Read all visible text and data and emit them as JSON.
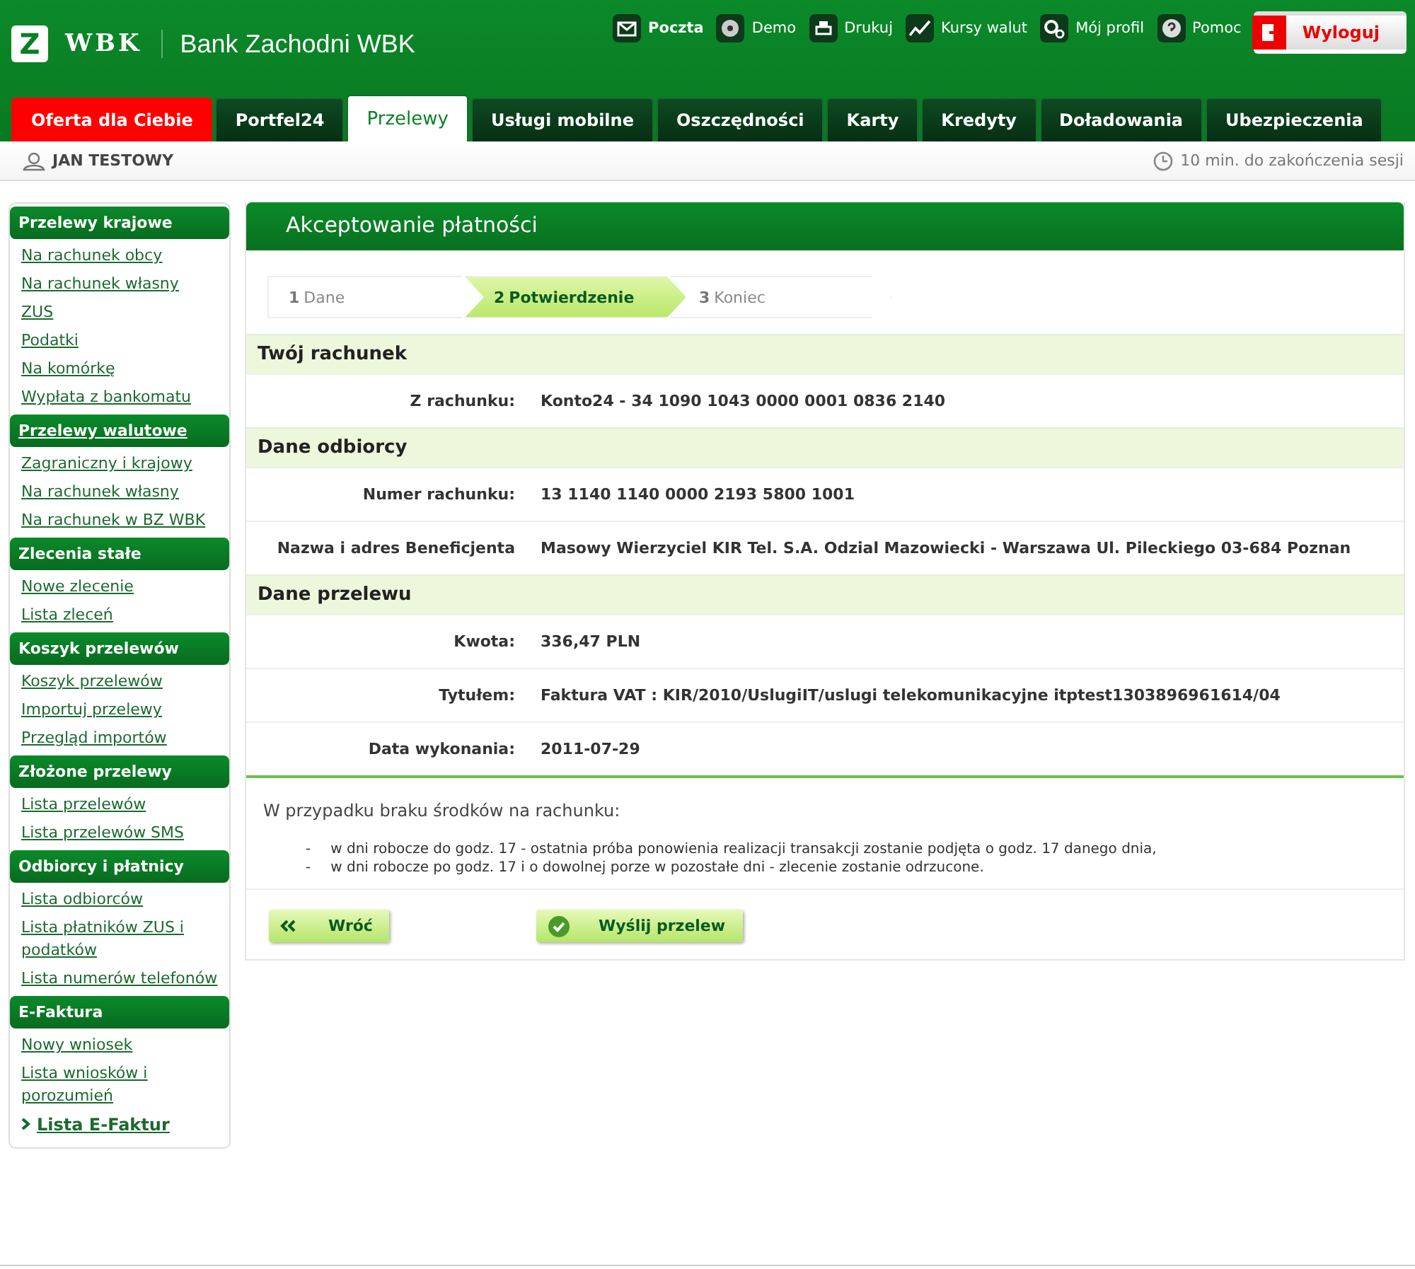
{
  "header": {
    "logo_mark": "Z",
    "logo_text": "WBK",
    "bank_name": "Bank Zachodni WBK",
    "top_links": [
      {
        "label": "Poczta",
        "kind": "mail",
        "bold": true
      },
      {
        "label": "Demo",
        "kind": "demo",
        "bold": false
      },
      {
        "label": "Drukuj",
        "kind": "print",
        "bold": false
      },
      {
        "label": "Kursy walut",
        "kind": "chart",
        "bold": false
      },
      {
        "label": "Mój profil",
        "kind": "gear",
        "bold": false
      },
      {
        "label": "Pomoc",
        "kind": "help",
        "bold": false
      }
    ],
    "logout": "Wyloguj"
  },
  "tabs": [
    {
      "label": "Oferta dla Ciebie",
      "kind": "promo",
      "selected": false
    },
    {
      "label": "Portfel24",
      "kind": "normal",
      "selected": false
    },
    {
      "label": "Przelewy",
      "kind": "normal",
      "selected": true
    },
    {
      "label": "Usługi mobilne",
      "kind": "normal",
      "selected": false
    },
    {
      "label": "Oszczędności",
      "kind": "normal",
      "selected": false
    },
    {
      "label": "Karty",
      "kind": "normal",
      "selected": false
    },
    {
      "label": "Kredyty",
      "kind": "normal",
      "selected": false
    },
    {
      "label": "Doładowania",
      "kind": "normal",
      "selected": false
    },
    {
      "label": "Ubezpieczenia",
      "kind": "normal",
      "selected": false
    }
  ],
  "user_bar": {
    "user": "JAN TESTOWY",
    "session": "10 min. do zakończenia sesji"
  },
  "sidebar": [
    {
      "heading": "Przelewy krajowe",
      "linked": false,
      "items": [
        {
          "label": "Na rachunek obcy",
          "selected": false
        },
        {
          "label": "Na rachunek własny",
          "selected": false
        },
        {
          "label": "ZUS",
          "selected": false
        },
        {
          "label": "Podatki",
          "selected": false
        },
        {
          "label": "Na komórkę",
          "selected": false
        },
        {
          "label": "Wypłata z bankomatu",
          "selected": false
        }
      ]
    },
    {
      "heading": "Przelewy walutowe",
      "linked": true,
      "items": [
        {
          "label": "Zagraniczny i krajowy",
          "selected": false
        },
        {
          "label": "Na rachunek własny",
          "selected": false
        },
        {
          "label": "Na rachunek w BZ WBK",
          "selected": false
        }
      ]
    },
    {
      "heading": "Zlecenia stałe",
      "linked": false,
      "items": [
        {
          "label": "Nowe zlecenie",
          "selected": false
        },
        {
          "label": "Lista zleceń",
          "selected": false
        }
      ]
    },
    {
      "heading": "Koszyk przelewów",
      "linked": false,
      "items": [
        {
          "label": "Koszyk przelewów",
          "selected": false
        },
        {
          "label": "Importuj przelewy",
          "selected": false
        },
        {
          "label": "Przegląd importów",
          "selected": false
        }
      ]
    },
    {
      "heading": "Złożone przelewy",
      "linked": false,
      "items": [
        {
          "label": "Lista przelewów",
          "selected": false
        },
        {
          "label": "Lista przelewów SMS",
          "selected": false
        }
      ]
    },
    {
      "heading": "Odbiorcy i płatnicy",
      "linked": false,
      "items": [
        {
          "label": "Lista odbiorców",
          "selected": false
        },
        {
          "label": "Lista płatników ZUS i podatków",
          "selected": false
        },
        {
          "label": "Lista numerów telefonów",
          "selected": false
        }
      ]
    },
    {
      "heading": "E-Faktura",
      "linked": false,
      "items": [
        {
          "label": "Nowy wniosek",
          "selected": false
        },
        {
          "label": "Lista wniosków i porozumień",
          "selected": false
        },
        {
          "label": "Lista E-Faktur",
          "selected": true
        }
      ]
    }
  ],
  "panel": {
    "title": "Akceptowanie płatności",
    "steps": [
      {
        "number": "1",
        "label": "Dane",
        "selected": false
      },
      {
        "number": "2",
        "label": "Potwierdzenie",
        "selected": true
      },
      {
        "number": "3",
        "label": "Koniec",
        "selected": false
      }
    ],
    "sections": [
      {
        "title": "Twój rachunek",
        "rows": [
          {
            "label": "Z rachunku:",
            "value": "Konto24 - 34 1090 1043 0000 0001 0836 2140"
          }
        ]
      },
      {
        "title": "Dane odbiorcy",
        "rows": [
          {
            "label": "Numer rachunku:",
            "value": "13 1140 1140 0000 2193 5800 1001"
          },
          {
            "label": "Nazwa i adres Beneficjenta",
            "value": "Masowy Wierzyciel KIR Tel. S.A. Odzial Mazowiecki - Warszawa Ul. Pileckiego 03-684 Poznan"
          }
        ]
      },
      {
        "title": "Dane przelewu",
        "rows": [
          {
            "label": "Kwota:",
            "value": "336,47 PLN"
          },
          {
            "label": "Tytułem:",
            "value": "Faktura VAT : KIR/2010/UslugiIT/uslugi telekomunikacyjne itptest1303896961614/04"
          },
          {
            "label": "Data wykonania:",
            "value": "2011-07-29"
          }
        ]
      }
    ],
    "note": {
      "heading": "W przypadku braku środków na rachunku:",
      "items": [
        {
          "marker": "-",
          "text": "w dni robocze do godz. 17 - ostatnia próba ponowienia realizacji transakcji zostanie podjęta o godz. 17 danego dnia,"
        },
        {
          "marker": "-",
          "text": "w dni robocze po godz. 17 i o dowolnej porze w pozostałe dni - zlecenie zostanie odrzucone."
        }
      ]
    },
    "buttons": [
      {
        "label": "Wróć",
        "kind": "back"
      },
      {
        "label": "Wyślij przelew",
        "kind": "send"
      }
    ]
  }
}
